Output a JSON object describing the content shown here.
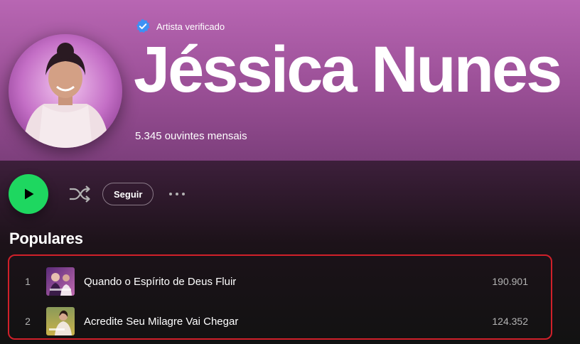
{
  "artist": {
    "verified_label": "Artista verificado",
    "name": "Jéssica Nunes",
    "monthly_listeners": "5.345 ouvintes mensais"
  },
  "controls": {
    "follow_label": "Seguir"
  },
  "popular": {
    "title": "Populares",
    "tracks": [
      {
        "number": "1",
        "title": "Quando o Espírito de Deus Fluir",
        "plays": "190.901"
      },
      {
        "number": "2",
        "title": "Acredite Seu Milagre Vai Chegar",
        "plays": "124.352"
      }
    ]
  },
  "icons": {
    "verified": "verified-badge-icon",
    "play": "play-icon",
    "shuffle": "shuffle-icon",
    "more": "more-options-icon"
  },
  "colors": {
    "header": "#b866b3",
    "play_button": "#1ed760",
    "verified_badge": "#3d91f4",
    "highlight_border": "#d0202a"
  }
}
